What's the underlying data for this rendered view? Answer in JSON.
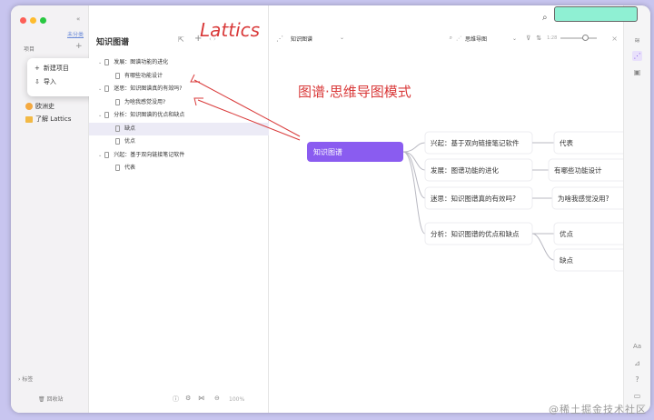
{
  "app": {
    "annotation_brand": "Lattics",
    "annotation_mode": "图谱·思维导图模式",
    "watermark": "@稀土掘金技术社区"
  },
  "sidebar": {
    "section_label": "项目",
    "top_link": "未分类",
    "items": [
      {
        "label": "欧洲史",
        "icon": "smile-icon"
      },
      {
        "label": "了解 Lattics",
        "icon": "folder-icon"
      }
    ],
    "tags_label": "标签",
    "trash_label": "回收站"
  },
  "context_menu": {
    "items": [
      "新建项目",
      "导入"
    ]
  },
  "outline": {
    "title": "知识图谱",
    "rows": [
      {
        "label": "发展：图谱功能的进化",
        "level": 0,
        "expanded": true,
        "selected": false
      },
      {
        "label": "有哪些功能设计",
        "level": 1,
        "expanded": false,
        "selected": false
      },
      {
        "label": "迷思：知识图谱真的有效吗?",
        "level": 0,
        "expanded": true,
        "selected": false
      },
      {
        "label": "为啥我感觉没用?",
        "level": 1,
        "expanded": false,
        "selected": false
      },
      {
        "label": "分析：知识图谱的优点和缺点",
        "level": 0,
        "expanded": true,
        "selected": false
      },
      {
        "label": "缺点",
        "level": 1,
        "expanded": false,
        "selected": true
      },
      {
        "label": "优点",
        "level": 1,
        "expanded": false,
        "selected": false
      },
      {
        "label": "兴起：基于双向链接笔记软件",
        "level": 0,
        "expanded": true,
        "selected": false
      },
      {
        "label": "代表",
        "level": 1,
        "expanded": false,
        "selected": false
      }
    ],
    "zoom": "100%"
  },
  "main": {
    "doc_selector": "知识图谱",
    "view_selector": "思维导图",
    "zoom_label": "1:28"
  },
  "mindmap": {
    "root": "知识图谱",
    "branches": [
      {
        "label": "兴起：基于双向链接笔记软件",
        "children": [
          "代表"
        ]
      },
      {
        "label": "发展：图谱功能的进化",
        "children": [
          "有哪些功能设计"
        ]
      },
      {
        "label": "迷思：知识图谱真的有效吗?",
        "children": [
          "为啥我感觉没用?"
        ]
      },
      {
        "label": "分析：知识图谱的优点和缺点",
        "children": [
          "优点",
          "缺点"
        ]
      }
    ]
  },
  "colors": {
    "accent": "#8a5cf0",
    "accent_dark": "#6a3cd8",
    "annotation": "#d93a3a",
    "search_box": "#8ff0d3"
  }
}
